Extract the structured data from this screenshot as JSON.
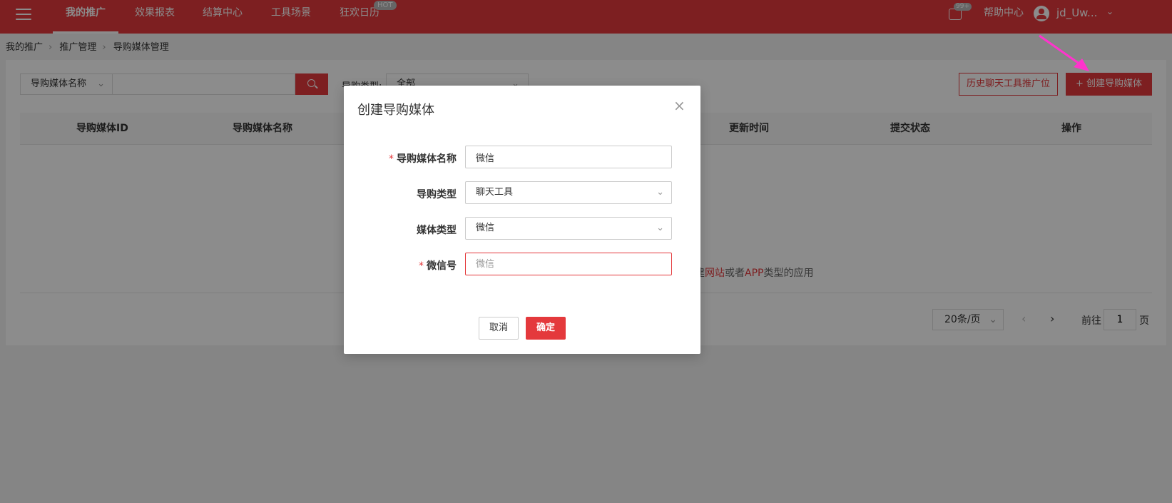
{
  "topnav": {
    "items": [
      {
        "label": "我的推广",
        "active": true
      },
      {
        "label": "效果报表"
      },
      {
        "label": "结算中心"
      },
      {
        "label": "工具场景"
      },
      {
        "label": "狂欢日历",
        "badge": "HOT"
      }
    ],
    "msg_badge": "99+",
    "help": "帮助中心",
    "username": "jd_Uw..."
  },
  "breadcrumb": [
    "我的推广",
    "推广管理",
    "导购媒体管理"
  ],
  "filters": {
    "field_select": "导购媒体名称",
    "type_label": "导购类型:",
    "type_value": "全部"
  },
  "buttons": {
    "history": "历史聊天工具推广位",
    "create": "+ 创建导购媒体"
  },
  "table": {
    "columns": [
      "导购媒体ID",
      "导购媒体名称",
      "更新时间",
      "提交状态",
      "操作"
    ],
    "empty_tip": {
      "prefix": "创建",
      "link1": "网站",
      "middle": "或者",
      "link2": "APP",
      "suffix": "类型的应用"
    }
  },
  "pagination": {
    "page_size": "20条/页",
    "goto_label": "前往",
    "current_page": "1",
    "unit": "页"
  },
  "modal": {
    "title": "创建导购媒体",
    "fields": [
      {
        "label": "导购媒体名称",
        "required": true,
        "value": "微信",
        "type": "input"
      },
      {
        "label": "导购类型",
        "required": false,
        "value": "聊天工具",
        "type": "select"
      },
      {
        "label": "媒体类型",
        "required": false,
        "value": "微信",
        "type": "select"
      },
      {
        "label": "微信号",
        "required": true,
        "placeholder": "微信",
        "type": "input",
        "error": true
      }
    ],
    "cancel": "取消",
    "confirm": "确定"
  },
  "colors": {
    "brand": "#e4393c",
    "annotation": "#ff33cc"
  }
}
